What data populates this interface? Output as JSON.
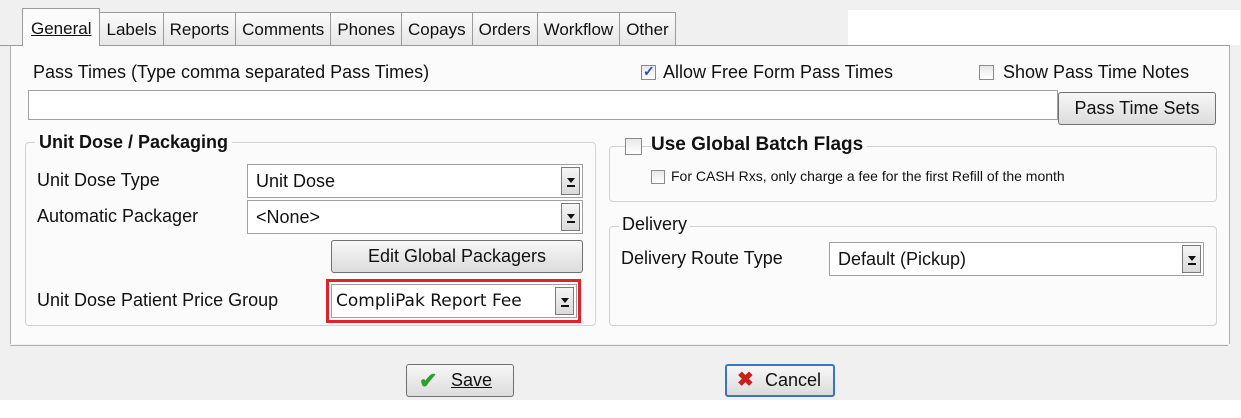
{
  "tabs": [
    {
      "label": "General",
      "active": true
    },
    {
      "label": "Labels"
    },
    {
      "label": "Reports"
    },
    {
      "label": "Comments"
    },
    {
      "label": "Phones"
    },
    {
      "label": "Copays"
    },
    {
      "label": "Orders"
    },
    {
      "label": "Workflow"
    },
    {
      "label": "Other"
    }
  ],
  "pass_times": {
    "label": "Pass Times (Type comma separated Pass Times)",
    "value": "",
    "allow_free_form": {
      "label": "Allow Free Form Pass Times",
      "checked": true
    },
    "show_notes": {
      "label": "Show Pass Time Notes",
      "checked": false
    },
    "sets_button": "Pass Time Sets"
  },
  "unit_dose": {
    "title": "Unit Dose / Packaging",
    "type_label": "Unit Dose Type",
    "type_value": "Unit Dose",
    "packager_label": "Automatic Packager",
    "packager_value": "<None>",
    "edit_button": "Edit Global Packagers",
    "price_group_label": "Unit Dose Patient Price Group",
    "price_group_value": "CompliPak Report Fee"
  },
  "batch": {
    "use_global": {
      "label": "Use Global Batch Flags",
      "checked": false
    },
    "cash_fee": {
      "label": "For CASH Rxs, only charge a fee for the first Refill of the month",
      "checked": false
    }
  },
  "delivery": {
    "title": "Delivery",
    "route_label": "Delivery Route Type",
    "route_value": "Default (Pickup)"
  },
  "footer": {
    "save": "Save",
    "cancel": "Cancel"
  },
  "colors": {
    "highlight": "#e0222a",
    "save_check": "#2e9e2e",
    "cancel_x": "#c8201a"
  }
}
